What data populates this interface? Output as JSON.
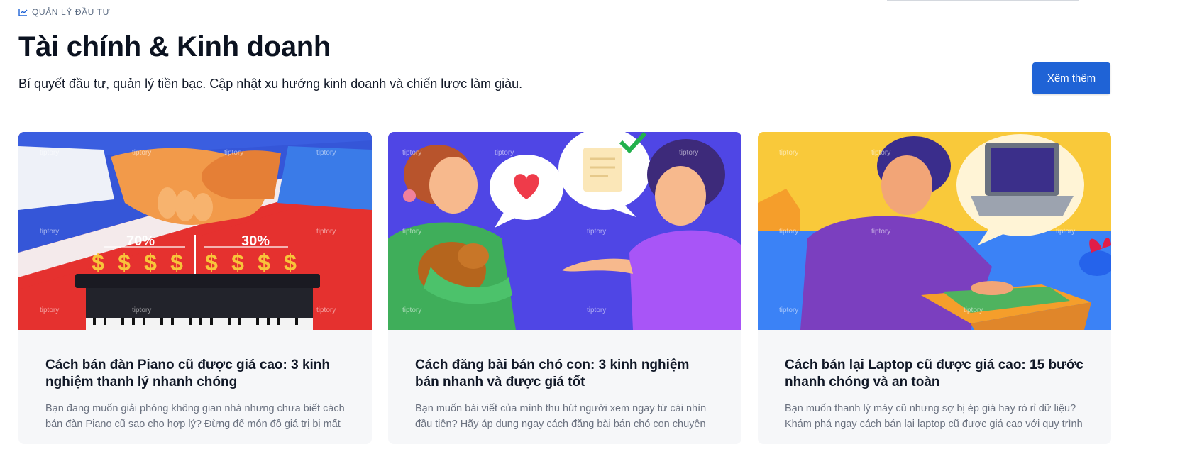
{
  "section": {
    "eyebrow_icon": "chart-line-icon",
    "eyebrow": "QUẢN LÝ ĐẦU TƯ",
    "title": "Tài chính & Kinh doanh",
    "subtitle": "Bí quyết đầu tư, quản lý tiền bạc. Cập nhật xu hướng kinh doanh và chiến lược làm giàu.",
    "more_button": "Xêm thêm",
    "accent": "#1f63d6"
  },
  "watermark": "tiptory",
  "cards": [
    {
      "title": "Cách bán đàn Piano cũ được giá cao: 3 kinh nghiệm thanh lý nhanh chóng",
      "excerpt": "Bạn đang muốn giải phóng không gian nhà nhưng chưa biết cách bán đàn Piano cũ sao cho hợp lý? Đừng để món đồ giá trị bị mất",
      "image": {
        "icon": "handshake-piano-illustration",
        "left_percent": "70%",
        "right_percent": "30%",
        "currency_symbol": "$"
      }
    },
    {
      "title": "Cách đăng bài bán chó con: 3 kinh nghiệm bán nhanh và được giá tốt",
      "excerpt": "Bạn muốn bài viết của mình thu hút người xem ngay từ cái nhìn đầu tiên? Hãy áp dụng ngay cách đăng bài bán chó con chuyên",
      "image": {
        "icon": "puppy-sale-conversation-illustration"
      }
    },
    {
      "title": "Cách bán lại Laptop cũ được giá cao: 15 bước nhanh chóng và an toàn",
      "excerpt": "Bạn muốn thanh lý máy cũ nhưng sợ bị ép giá hay rò rỉ dữ liệu? Khám phá ngay cách bán lại laptop cũ được giá cao với quy trình",
      "image": {
        "icon": "laptop-packing-illustration"
      }
    }
  ]
}
